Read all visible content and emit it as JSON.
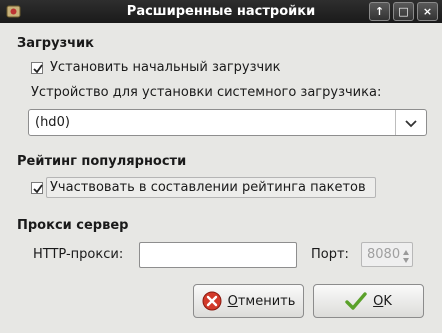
{
  "window": {
    "title": "Расширенные настройки",
    "controls": [
      "↑",
      "□",
      "×"
    ]
  },
  "bootloader": {
    "section_title": "Загрузчик",
    "install_checkbox": {
      "label": "Установить начальный загрузчик",
      "checked": true
    },
    "device_label": "Устройство для установки системного загрузчика:",
    "device_value": "(hd0)"
  },
  "popularity": {
    "section_title": "Рейтинг популярности",
    "participate_checkbox": {
      "label": "Участвовать в составлении рейтинга пакетов",
      "checked": true
    }
  },
  "proxy": {
    "section_title": "Прокси сервер",
    "http_label": "HTTP-прокси:",
    "http_value": "",
    "port_label": "Порт:",
    "port_value": "8080"
  },
  "buttons": {
    "cancel_first": "О",
    "cancel_rest": "тменить",
    "ok_first": "O",
    "ok_rest": "K"
  },
  "icons": {
    "app": "app-icon",
    "cancel": "cancel-icon",
    "ok": "checkmark-icon",
    "dropdown": "chevron-down-icon"
  }
}
